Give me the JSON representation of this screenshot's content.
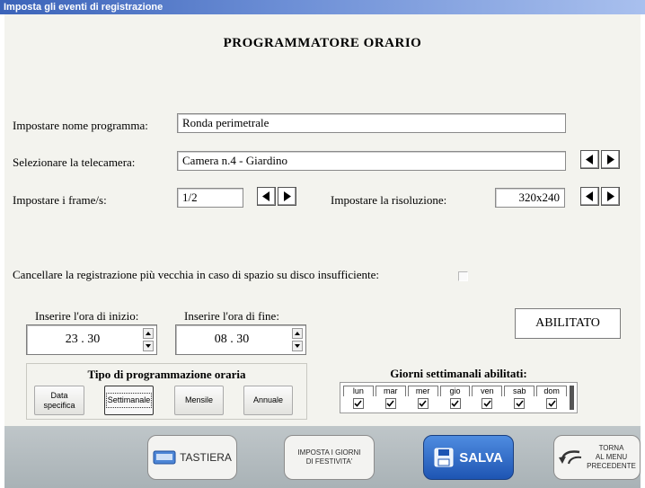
{
  "window": {
    "title": "Imposta gli eventi di registrazione"
  },
  "heading": "PROGRAMMATORE ORARIO",
  "program_name": {
    "label": "Impostare nome programma:",
    "value": "Ronda perimetrale"
  },
  "camera": {
    "label": "Selezionare la telecamera:",
    "value": "Camera n.4 - Giardino"
  },
  "frames": {
    "label": "Impostare i frame/s:",
    "value": "1/2"
  },
  "resolution": {
    "label": "Impostare la risoluzione:",
    "value": "320x240"
  },
  "overwrite": {
    "label": "Cancellare la registrazione più vecchia in caso di spazio su disco insufficiente:",
    "checked": false
  },
  "start_time": {
    "label": "Inserire l'ora di inizio:",
    "value": "23 . 30"
  },
  "end_time": {
    "label": "Inserire l'ora di fine:",
    "value": "08 . 30"
  },
  "status": "ABILITATO",
  "schedule_type": {
    "title": "Tipo di programmazione oraria",
    "options": [
      "Data specifica",
      "Settimanale",
      "Mensile",
      "Annuale"
    ],
    "selected": "Settimanale"
  },
  "days": {
    "title": "Giorni settimanali abilitati:",
    "items": [
      {
        "label": "lun",
        "checked": true
      },
      {
        "label": "mar",
        "checked": true
      },
      {
        "label": "mer",
        "checked": true
      },
      {
        "label": "gio",
        "checked": true
      },
      {
        "label": "ven",
        "checked": true
      },
      {
        "label": "sab",
        "checked": true
      },
      {
        "label": "dom",
        "checked": true
      }
    ]
  },
  "footer": {
    "keyboard": "TASTIERA",
    "holidays_line1": "IMPOSTA I GIORNI",
    "holidays_line2": "DI FESTIVITA'",
    "save": "SALVA",
    "back_line1": "TORNA",
    "back_line2": "AL MENU",
    "back_line3": "PRECEDENTE"
  },
  "colors": {
    "titlebar": "#3b63b9",
    "save_button": "#2a66c6",
    "panel": "#f3f3ee",
    "footer": "#b4bcc0"
  },
  "icons": [
    "arrow-left-icon",
    "arrow-right-icon",
    "spin-up-icon",
    "spin-down-icon",
    "keyboard-icon",
    "floppy-disk-icon",
    "back-arrow-icon"
  ]
}
